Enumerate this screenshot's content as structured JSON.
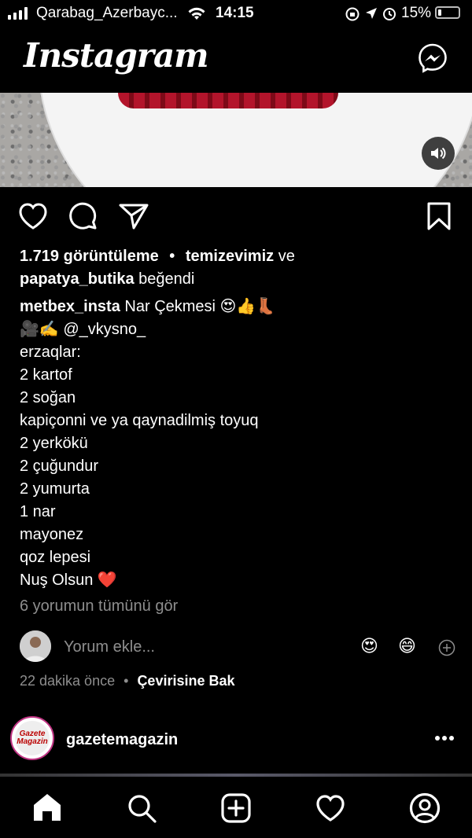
{
  "status_bar": {
    "carrier": "Qarabag_Azerbayc...",
    "time": "14:15",
    "battery": "15%"
  },
  "header": {
    "logo": "Instagram"
  },
  "post": {
    "views": "1.719 görüntüleme",
    "separator": "•",
    "liked_by_1": "temizevimiz",
    "and": "ve",
    "liked_by_2": "papatya_butika",
    "liked_suffix": "beğendi",
    "author": "metbex_insta",
    "caption_title": "Nar Çekmesi 😍👍👢",
    "caption_credit": "🎥✍️ @_vkysno_",
    "caption_lines": [
      "erzaqlar:",
      "2 kartof",
      "2 soğan",
      "kapiçonni ve ya qaynadilmiş toyuq",
      "2 yerkökü",
      "2 çuğundur",
      "2 yumurta",
      "1 nar",
      "mayonez",
      "qoz lepesi",
      "Nuş Olsun ❤️"
    ],
    "view_comments": "6 yorumun tümünü gör",
    "comment_placeholder": "Yorum ekle...",
    "emoji_1": "😍",
    "emoji_2": "😄",
    "time_ago": "22 dakika önce",
    "translate": "Çevirisine Bak"
  },
  "next_post": {
    "username": "gazetemagazin",
    "avatar_text": "Gazete Magazin"
  },
  "icons": [
    "messenger-icon",
    "sound-icon",
    "heart-icon",
    "comment-icon",
    "share-icon",
    "bookmark-icon",
    "home-icon",
    "search-icon",
    "add-icon",
    "activity-icon",
    "profile-icon"
  ]
}
